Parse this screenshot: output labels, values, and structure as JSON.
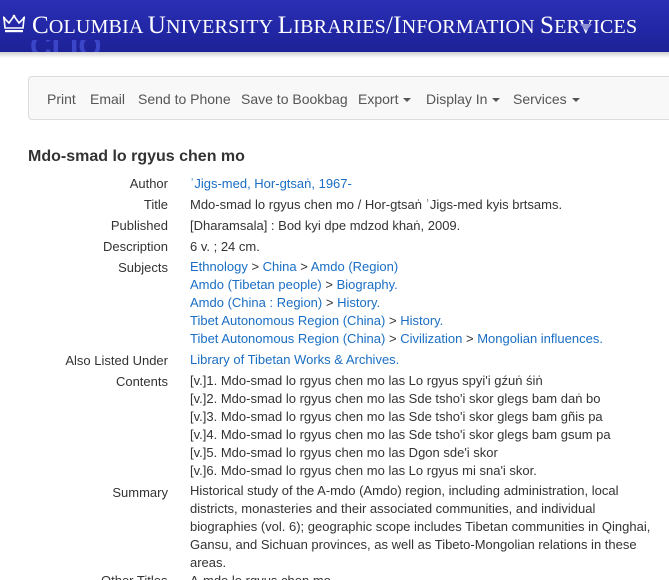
{
  "header": {
    "title_prefix": "C",
    "title_rest": "OLUMBIA ",
    "title_u": "U",
    "title_niversity": "NIVERSITY ",
    "title_l": "L",
    "title_ibraries": "IBRARIES",
    "title_slash": "/",
    "title_i": "I",
    "title_nformation": "NFORMATION ",
    "title_s": "S",
    "title_ervices": "ERVICES",
    "logo_partial": "CLIO"
  },
  "toolbar": {
    "print": "Print",
    "email": "Email",
    "send_to_phone": "Send to Phone",
    "save_to_bookbag": "Save to Bookbag",
    "export": "Export",
    "display_in": "Display In",
    "services": "Services"
  },
  "record": {
    "title": "Mdo-smad lo rgyus chen mo",
    "labels": {
      "author": "Author",
      "title": "Title",
      "published": "Published",
      "description": "Description",
      "subjects": "Subjects",
      "also_listed_under": "Also Listed Under",
      "contents": "Contents",
      "summary": "Summary",
      "other_titles": "Other Titles"
    },
    "author": "ʾJigs-med, Hor-gtsaṅ, 1967-",
    "title_full": "Mdo-smad lo rgyus chen mo / Hor-gtsaṅ ʾJigs-med kyis brtsams.",
    "published": "[Dharamsala] : Bod kyi dpe mdzod khaṅ, 2009.",
    "description": "6 v. ; 24 cm.",
    "subjects": [
      [
        "Ethnology",
        "China",
        "Amdo (Region)"
      ],
      [
        "Amdo (Tibetan people)",
        "Biography."
      ],
      [
        "Amdo (China : Region)",
        "History."
      ],
      [
        "Tibet Autonomous Region (China)",
        "History."
      ],
      [
        "Tibet Autonomous Region (China)",
        "Civilization",
        "Mongolian influences."
      ]
    ],
    "subject_separator": ">",
    "also_listed_under": "Library of Tibetan Works & Archives.",
    "contents": [
      "[v.]1. Mdo-smad lo rgyus chen mo las Lo rgyus spyi'i gźuṅ śiṅ",
      "[v.]2. Mdo-smad lo rgyus chen mo las Sde tsho'i skor glegs bam daṅ bo",
      "[v.]3. Mdo-smad lo rgyus chen mo las Sde tsho'i skor glegs bam gñis pa",
      "[v.]4. Mdo-smad lo rgyus chen mo las Sde tsho'i skor glegs bam gsum pa",
      "[v.]5. Mdo-smad lo rgyus chen mo las Dgon sde'i skor",
      "[v.]6. Mdo-smad lo rgyus chen mo las Lo rgyus mi sna'i skor."
    ],
    "summary": "Historical study of the A-mdo (Amdo) region, including administration, local districts, monasteries and their associated communities, and individual biographies (vol. 6); geographic scope includes Tibetan communities in Qinghai, Gansu, and Sichuan provinces, as well as Tibeto-Mongolian relations in these areas.",
    "other_titles": "A-mdo lo rgyus chen mo"
  },
  "colors": {
    "banner": "#2227a6",
    "link": "#1a6ec4",
    "text": "#333333"
  }
}
